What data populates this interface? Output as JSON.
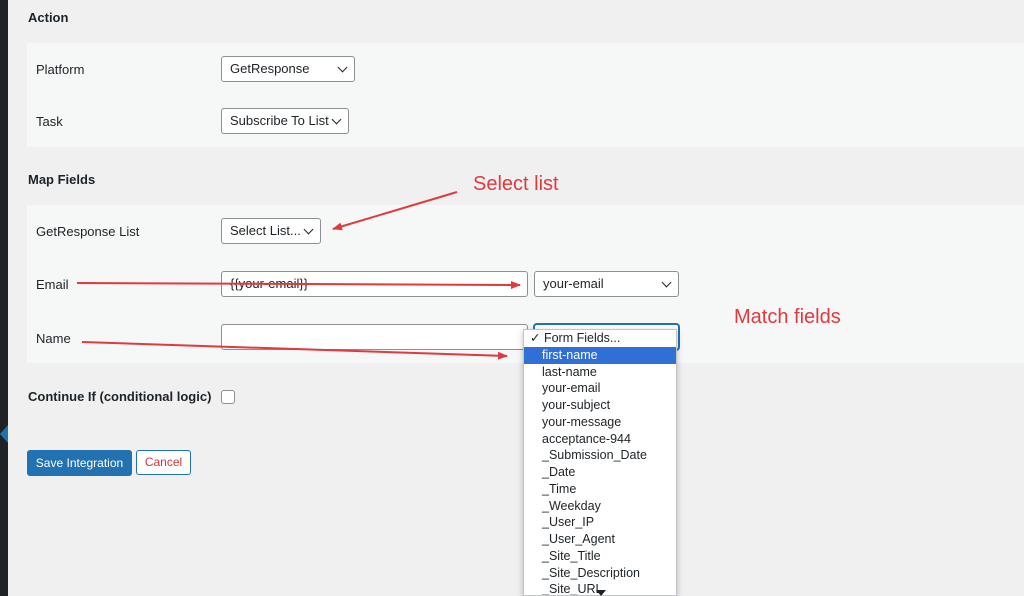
{
  "sections": {
    "action": "Action",
    "map_fields": "Map Fields"
  },
  "action_rows": {
    "platform": {
      "label": "Platform",
      "value": "GetResponse"
    },
    "task": {
      "label": "Task",
      "value": "Subscribe To List"
    }
  },
  "map_rows": {
    "list": {
      "label": "GetResponse List",
      "value": "Select List..."
    },
    "email": {
      "label": "Email",
      "input_value": "{{your-email}}",
      "select_value": "your-email"
    },
    "name": {
      "label": "Name",
      "input_value": "",
      "select_value": "Form Fields..."
    }
  },
  "conditional": {
    "label": "Continue If (conditional logic)",
    "checked": false
  },
  "buttons": {
    "save": "Save Integration",
    "cancel": "Cancel"
  },
  "dropdown": {
    "selected": "Form Fields...",
    "highlighted": "first-name",
    "options": [
      "Form Fields...",
      "first-name",
      "last-name",
      "your-email",
      "your-subject",
      "your-message",
      "acceptance-944",
      "_Submission_Date",
      "_Date",
      "_Time",
      "_Weekday",
      "_User_IP",
      "_User_Agent",
      "_Site_Title",
      "_Site_Description",
      "_Site_URL"
    ]
  },
  "annotations": {
    "select_list": "Select list",
    "match_fields": "Match fields"
  },
  "colors": {
    "annotation": "#e03a3e",
    "primary": "#2271b1",
    "highlight": "#2f6fd6",
    "cancel_text": "#d63638"
  }
}
